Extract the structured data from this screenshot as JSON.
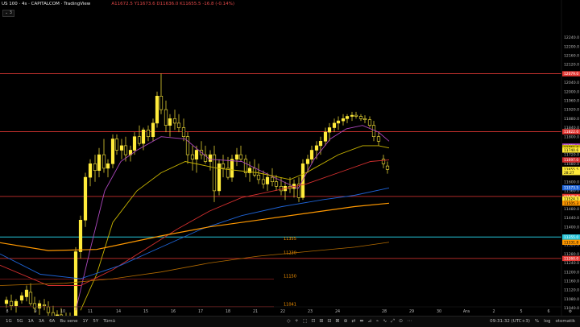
{
  "header": {
    "symbol": "US 100 · 4s · CAPITALCOM · TradingView",
    "ohlc": "A11672.5  Y11673.6  D11636.0  K11655.5  -16.8 (-0.14%)",
    "collapse": "3"
  },
  "colors": {
    "candle": "#ffeb3b",
    "red_line": "#e53935",
    "cyan_line": "#26c6da",
    "ma_fast": "#ab47bc",
    "ma_mid": "#c8b400",
    "ma_slow": "#d32f2f",
    "ma_blue": "#1e63d6",
    "ma_orange": "#ff9800"
  },
  "price_axis": {
    "ticks": [
      "12240.0",
      "12200.0",
      "12160.0",
      "12120.0",
      "12040.0",
      "12000.0",
      "11960.0",
      "11920.0",
      "11880.0",
      "11840.0",
      "11800.0",
      "11720.0",
      "11680.0",
      "11600.0",
      "11560.0",
      "11480.0",
      "11440.0",
      "11400.0",
      "11360.0",
      "11320.0",
      "11280.0",
      "11240.0",
      "11200.0",
      "11160.0",
      "11120.0",
      "11080.0",
      "11040.0"
    ],
    "tags": [
      {
        "label": "12079.0",
        "value": 12079,
        "color": "#e53935"
      },
      {
        "label": "11822.0",
        "value": 11822,
        "color": "#e53935"
      },
      {
        "label": "11758.4",
        "value": 11758.4,
        "color": "#ab47bc"
      },
      {
        "label": "11751.6",
        "value": 11751.6,
        "color": "#c8b400"
      },
      {
        "label": "11740.6",
        "value": 11740.6,
        "color": "#ffeb3b"
      },
      {
        "label": "11697.0",
        "value": 11697,
        "color": "#d32f2f"
      },
      {
        "label": "11655.5",
        "value": 11655.5,
        "color": "#ffeb3b"
      },
      {
        "label": "28:27",
        "value": 11641,
        "color": "#ffeb3b"
      },
      {
        "label": "11573.5",
        "value": 11573.5,
        "color": "#1e63d6"
      },
      {
        "label": "11535.0",
        "value": 11535,
        "color": "#e53935"
      },
      {
        "label": "11524.3",
        "value": 11524.3,
        "color": "#ffeb3b"
      },
      {
        "label": "11505.3",
        "value": 11505.3,
        "color": "#ff9800"
      },
      {
        "label": "11355.0",
        "value": 11355,
        "color": "#26c6da"
      },
      {
        "label": "11331.8",
        "value": 11331.8,
        "color": "#ff9800"
      },
      {
        "label": "11260.0",
        "value": 11260,
        "color": "#e53935"
      }
    ]
  },
  "levels": [
    {
      "label": "11355",
      "value": 11334,
      "color": "#ff9800"
    },
    {
      "label": "11230",
      "value": 11272,
      "color": "#ff9800"
    },
    {
      "label": "11150",
      "value": 11168,
      "color": "#ff9800"
    },
    {
      "label": "11041",
      "value": 11044,
      "color": "#ff9800"
    }
  ],
  "x_axis": [
    "8",
    "9",
    "10",
    "11",
    "14",
    "15",
    "16",
    "17",
    "18",
    "21",
    "22",
    "23",
    "24",
    "28",
    "29",
    "30",
    "Ara",
    "2",
    "5",
    "6"
  ],
  "bottom": {
    "timeframes": [
      "1G",
      "5G",
      "1A",
      "3A",
      "6A",
      "Bu sene",
      "1Y",
      "5Y",
      "Tümü"
    ],
    "tool_icons": [
      "◇",
      "+",
      "⬚",
      "⊡",
      "⊞",
      "⊟",
      "⊠",
      "⊕",
      "⇄",
      "⬌",
      "⊿",
      "⌁",
      "∿",
      "⤢",
      "⊙",
      "⋯"
    ],
    "clock": "09:31:32 (UTC+3)",
    "pct": "%",
    "log": "log",
    "auto": "otomatik"
  }
}
